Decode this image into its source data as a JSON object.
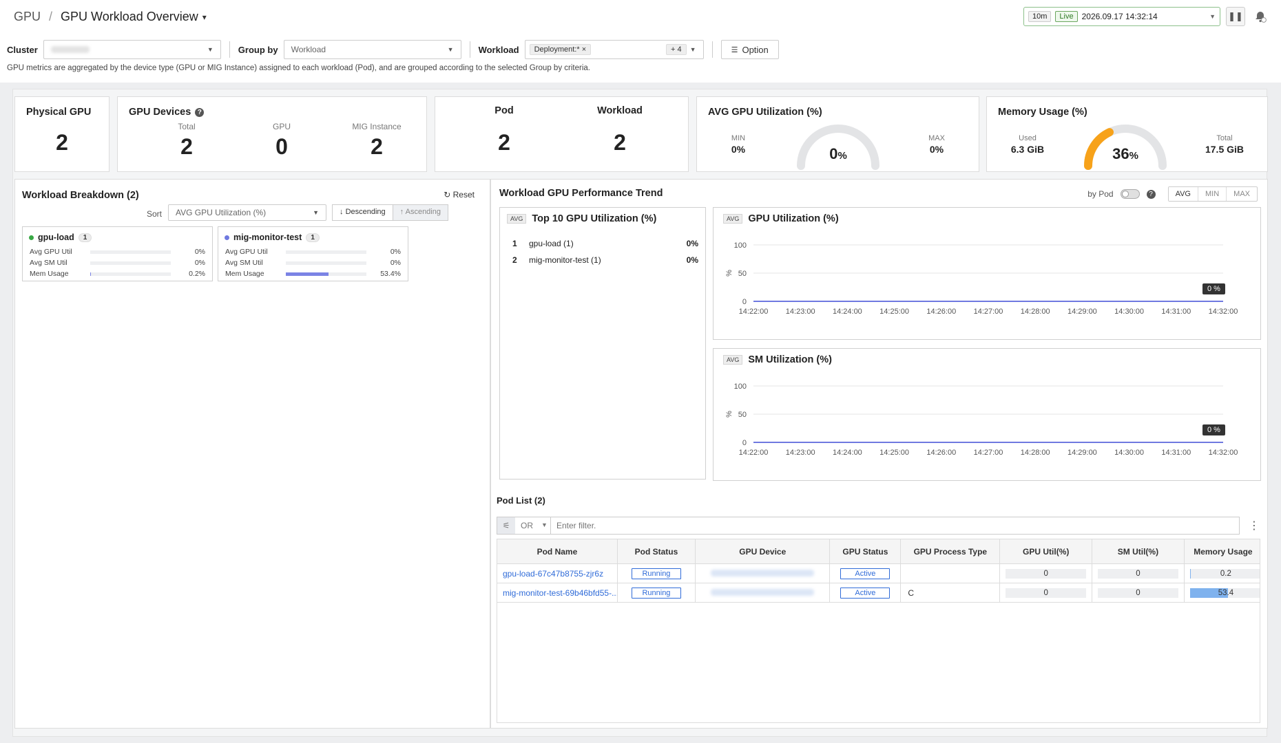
{
  "breadcrumb": {
    "root": "GPU",
    "separator": "/",
    "title": "GPU Workload Overview"
  },
  "header": {
    "range": "10m",
    "live": "Live",
    "datetime": "2026.09.17 14:32:14",
    "alert_count": "0"
  },
  "filters": {
    "cluster_label": "Cluster",
    "groupby_label": "Group by",
    "groupby_value": "Workload",
    "workload_label": "Workload",
    "workload_chip": "Deployment:*",
    "workload_more": "+ 4",
    "option_label": "Option"
  },
  "description": "GPU metrics are aggregated by the device type (GPU or MIG Instance) assigned to each workload (Pod), and are grouped according to the selected Group by criteria.",
  "summary": {
    "physical_gpu": {
      "title": "Physical GPU",
      "value": "2"
    },
    "gpu_devices": {
      "title": "GPU Devices",
      "total_label": "Total",
      "total": "2",
      "gpu_label": "GPU",
      "gpu": "0",
      "mig_label": "MIG Instance",
      "mig": "2"
    },
    "pod": {
      "title": "Pod",
      "value": "2"
    },
    "workload": {
      "title": "Workload",
      "value": "2"
    },
    "avg_util": {
      "title": "AVG GPU Utilization (%)",
      "min_label": "MIN",
      "min": "0%",
      "max_label": "MAX",
      "max": "0%",
      "value": "0",
      "unit": "%",
      "fraction": 0.0
    },
    "memory": {
      "title": "Memory Usage (%)",
      "used_label": "Used",
      "used": "6.3 GiB",
      "total_label": "Total",
      "total": "17.5 GiB",
      "value": "36",
      "unit": "%",
      "fraction": 0.36
    }
  },
  "breakdown": {
    "title": "Workload Breakdown (2)",
    "reset": "Reset",
    "sort_label": "Sort",
    "sort_value": "AVG GPU Utilization (%)",
    "descending": "Descending",
    "ascending": "Ascending",
    "cards": [
      {
        "name": "gpu-load",
        "count": "1",
        "dot": "#39a845",
        "rows": [
          {
            "label": "Avg GPU Util",
            "value": "0%",
            "pct": 0
          },
          {
            "label": "Avg SM Util",
            "value": "0%",
            "pct": 0
          },
          {
            "label": "Mem Usage",
            "value": "0.2%",
            "pct": 0.2
          }
        ]
      },
      {
        "name": "mig-monitor-test",
        "count": "1",
        "dot": "#6f79e0",
        "rows": [
          {
            "label": "Avg GPU Util",
            "value": "0%",
            "pct": 0
          },
          {
            "label": "Avg SM Util",
            "value": "0%",
            "pct": 0
          },
          {
            "label": "Mem Usage",
            "value": "53.4%",
            "pct": 53.4
          }
        ]
      }
    ]
  },
  "trend": {
    "title": "Workload GPU Performance Trend",
    "bypod": "by Pod",
    "agg": [
      "AVG",
      "MIN",
      "MAX"
    ],
    "top10": {
      "tag": "AVG",
      "title": "Top 10 GPU Utilization (%)",
      "items": [
        {
          "rank": "1",
          "name": "gpu-load (1)",
          "value": "0%"
        },
        {
          "rank": "2",
          "name": "mig-monitor-test (1)",
          "value": "0%"
        }
      ]
    }
  },
  "chart_data": [
    {
      "type": "line",
      "tag": "AVG",
      "title": "GPU Utilization (%)",
      "ylabel": "%",
      "ylim": [
        0,
        100
      ],
      "yticks": [
        "0",
        "50",
        "100"
      ],
      "x": [
        "14:22:00",
        "14:23:00",
        "14:24:00",
        "14:25:00",
        "14:26:00",
        "14:27:00",
        "14:28:00",
        "14:29:00",
        "14:30:00",
        "14:31:00",
        "14:32:00"
      ],
      "series": [
        {
          "values": [
            0,
            0,
            0,
            0,
            0,
            0,
            0,
            0,
            0,
            0,
            0
          ],
          "color": "#6f79e0"
        }
      ],
      "tooltip": "0 %"
    },
    {
      "type": "line",
      "tag": "AVG",
      "title": "SM Utilization (%)",
      "ylabel": "%",
      "ylim": [
        0,
        100
      ],
      "yticks": [
        "0",
        "50",
        "100"
      ],
      "x": [
        "14:22:00",
        "14:23:00",
        "14:24:00",
        "14:25:00",
        "14:26:00",
        "14:27:00",
        "14:28:00",
        "14:29:00",
        "14:30:00",
        "14:31:00",
        "14:32:00"
      ],
      "series": [
        {
          "values": [
            0,
            0,
            0,
            0,
            0,
            0,
            0,
            0,
            0,
            0,
            0
          ],
          "color": "#6f79e0"
        }
      ],
      "tooltip": "0 %"
    }
  ],
  "podlist": {
    "title": "Pod List (2)",
    "logic": "OR",
    "filter_placeholder": "Enter filter.",
    "columns": [
      "Pod Name",
      "Pod Status",
      "GPU Device",
      "GPU Status",
      "GPU Process Type",
      "GPU Util(%)",
      "SM Util(%)",
      "Memory Usage"
    ],
    "rows": [
      {
        "name": "gpu-load-67c47b8755-zjr6z",
        "status": "Running",
        "gpu_status": "Active",
        "ptype": "",
        "gpu_util": "0",
        "sm_util": "0",
        "mem": "0.2",
        "mem_pct": 0.2
      },
      {
        "name": "mig-monitor-test-69b46bfd55-...",
        "status": "Running",
        "gpu_status": "Active",
        "ptype": "C",
        "gpu_util": "0",
        "sm_util": "0",
        "mem": "53.4",
        "mem_pct": 53.4
      }
    ]
  }
}
